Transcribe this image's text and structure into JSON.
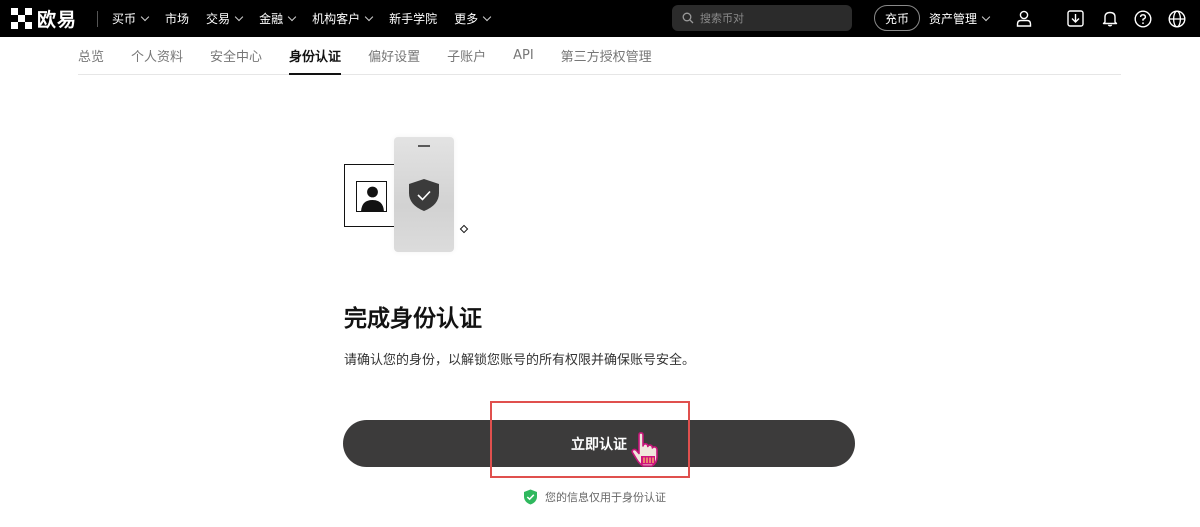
{
  "header": {
    "logo_text": "欧易",
    "nav": [
      {
        "label": "买币",
        "has_dropdown": true
      },
      {
        "label": "市场",
        "has_dropdown": false
      },
      {
        "label": "交易",
        "has_dropdown": true
      },
      {
        "label": "金融",
        "has_dropdown": true
      },
      {
        "label": "机构客户",
        "has_dropdown": true
      },
      {
        "label": "新手学院",
        "has_dropdown": false
      },
      {
        "label": "更多",
        "has_dropdown": true
      }
    ],
    "search_placeholder": "搜索币对",
    "deposit_label": "充币",
    "assets_label": "资产管理",
    "icons": [
      "user-icon",
      "download-icon",
      "bell-icon",
      "help-icon",
      "globe-icon"
    ]
  },
  "tabs": [
    {
      "label": "总览",
      "active": false
    },
    {
      "label": "个人资料",
      "active": false
    },
    {
      "label": "安全中心",
      "active": false
    },
    {
      "label": "身份认证",
      "active": true
    },
    {
      "label": "偏好设置",
      "active": false
    },
    {
      "label": "子账户",
      "active": false
    },
    {
      "label": "API",
      "active": false
    },
    {
      "label": "第三方授权管理",
      "active": false
    }
  ],
  "main": {
    "title": "完成身份认证",
    "description": "请确认您的身份，以解锁您账号的所有权限并确保账号安全。",
    "button_label": "立即认证",
    "privacy_note": "您的信息仅用于身份认证"
  },
  "colors": {
    "nav_bg": "#000000",
    "button_bg": "#3c3b3b",
    "highlight": "#e0504e",
    "check_green": "#2fb85e"
  }
}
